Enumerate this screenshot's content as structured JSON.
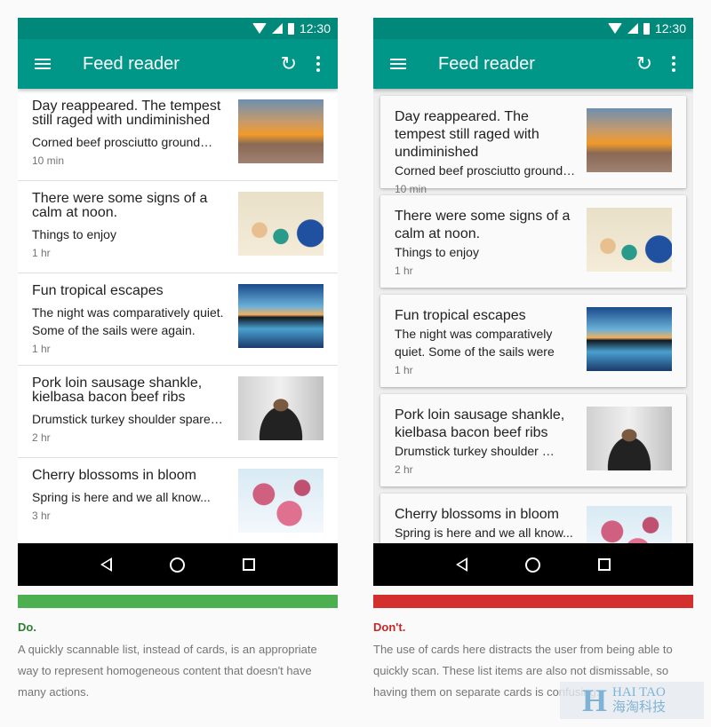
{
  "status_time": "12:30",
  "app_title": "Feed reader",
  "colors": {
    "primary": "#009688",
    "status": "#00897b",
    "do": "#4caf50",
    "dont": "#d32f2f",
    "do_text": "#2e7d32",
    "dont_text": "#c62828"
  },
  "left": {
    "items": [
      {
        "title": "Day reappeared. The tempest still raged with undiminished",
        "subtitle": "Corned beef prosciutto ground…",
        "meta": "10 min",
        "image": "city"
      },
      {
        "title": "There were some signs of a calm at noon.",
        "subtitle": "Things to enjoy",
        "meta": "1 hr",
        "image": "family"
      },
      {
        "title": "Fun tropical escapes",
        "subtitle": "The night was comparatively quiet. Some of the sails were again.",
        "meta": "1 hr",
        "image": "tropical"
      },
      {
        "title": "Pork loin sausage shankle, kielbasa bacon beef ribs",
        "subtitle": "Drumstick turkey shoulder spare…",
        "meta": "2 hr",
        "image": "person"
      },
      {
        "title": "Cherry blossoms in bloom",
        "subtitle": "Spring is here and we all know...",
        "meta": "3 hr",
        "image": "blossom"
      }
    ],
    "label": "Do.",
    "description": "A quickly scannable list, instead of cards, is an appropriate way to represent homogeneous content that doesn't have many actions."
  },
  "right": {
    "items": [
      {
        "title": "Day reappeared. The tempest still raged with undiminished",
        "subtitle": "Corned beef prosciutto ground…",
        "meta": "10 min",
        "image": "city"
      },
      {
        "title": "There were some signs of a calm at noon.",
        "subtitle": "Things to enjoy",
        "meta": "1 hr",
        "image": "family"
      },
      {
        "title": "Fun tropical escapes",
        "subtitle": "The night was comparatively quiet. Some of the sails were",
        "meta": "1 hr",
        "image": "tropical"
      },
      {
        "title": "Pork loin sausage shankle, kielbasa bacon beef ribs",
        "subtitle": "Drumstick turkey shoulder …",
        "meta": "2 hr",
        "image": "person"
      },
      {
        "title": "Cherry blossoms in bloom",
        "subtitle": "Spring is here and we all know...",
        "meta": "",
        "image": "blossom"
      }
    ],
    "label": "Don't.",
    "description": "The use of cards here distracts the user from being able to quickly scan. These list items are also not dismissable, so having them on separate cards is confusing."
  },
  "watermark": {
    "letter": "H",
    "text": "HAI TAO",
    "text_cn": "海淘科技"
  }
}
